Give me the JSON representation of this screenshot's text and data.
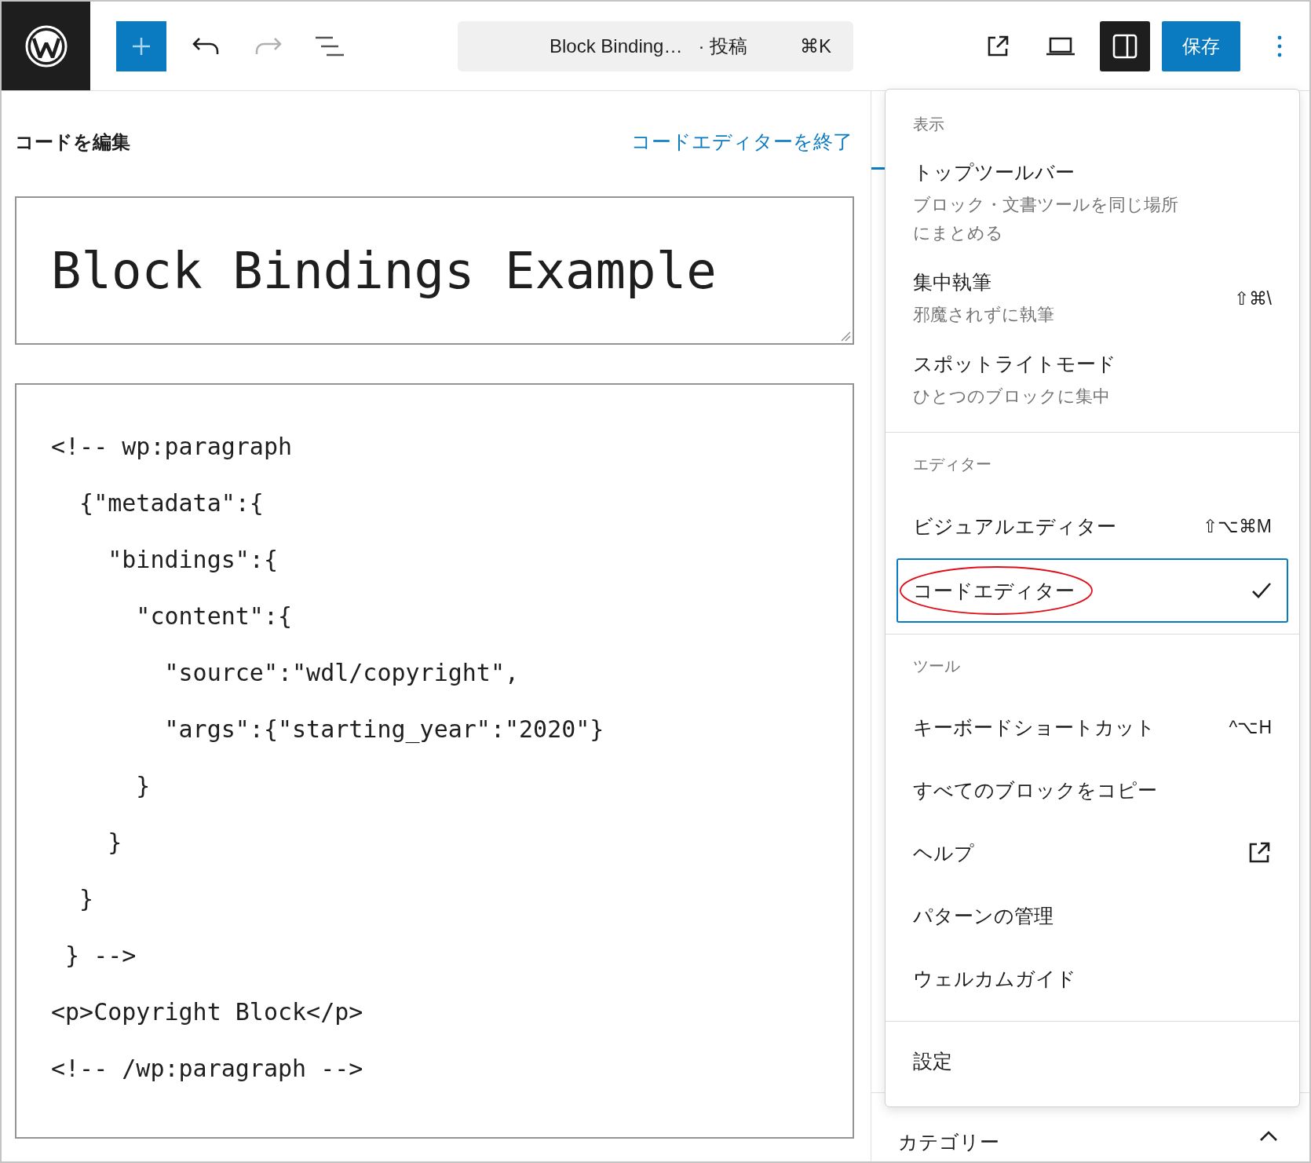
{
  "toolbar": {
    "title": "Block Binding…",
    "post_type": "· 投稿",
    "shortcut": "⌘K",
    "save": "保存",
    "undo_disabled": false,
    "redo_disabled": true,
    "sidebar_open": true
  },
  "editor": {
    "heading": "コードを編集",
    "exit_link": "コードエディターを終了",
    "title": "Block Bindings Example",
    "code_lines": [
      "<!-- wp:paragraph",
      "  {\"metadata\":{",
      "    \"bindings\":{",
      "      \"content\":{",
      "        \"source\":\"wdl/copyright\",",
      "        \"args\":{\"starting_year\":\"2020\"}",
      "      }",
      "    }",
      "  }",
      " } -->",
      "<p>Copyright Block</p>",
      "<!-- /wp:paragraph -->"
    ]
  },
  "sidebar": {
    "panel_title": "カテゴリー",
    "expanded": true
  },
  "menu": {
    "groups": [
      {
        "heading": "表示",
        "items": [
          {
            "kind": "toggle",
            "label": "トップツールバー",
            "description": "ブロック・文書ツールを同じ場所にまとめる",
            "checked": false
          },
          {
            "kind": "toggle",
            "label": "集中執筆",
            "description": "邪魔されずに執筆",
            "checked": false,
            "shortcut": "⇧⌘\\"
          },
          {
            "kind": "toggle",
            "label": "スポットライトモード",
            "description": "ひとつのブロックに集中",
            "checked": false
          }
        ]
      },
      {
        "heading": "エディター",
        "items": [
          {
            "kind": "radio",
            "label": "ビジュアルエディター",
            "selected": false,
            "shortcut": "⇧⌥⌘M"
          },
          {
            "kind": "radio",
            "label": "コードエディター",
            "selected": true,
            "circled": true
          }
        ]
      },
      {
        "heading": "ツール",
        "items": [
          {
            "kind": "action",
            "label": "キーボードショートカット",
            "shortcut": "^⌥H"
          },
          {
            "kind": "action",
            "label": "すべてのブロックをコピー"
          },
          {
            "kind": "action",
            "label": "ヘルプ",
            "external": true
          },
          {
            "kind": "action",
            "label": "パターンの管理"
          },
          {
            "kind": "action",
            "label": "ウェルカムガイド"
          }
        ]
      },
      {
        "items": [
          {
            "kind": "action",
            "label": "設定"
          }
        ]
      }
    ]
  }
}
